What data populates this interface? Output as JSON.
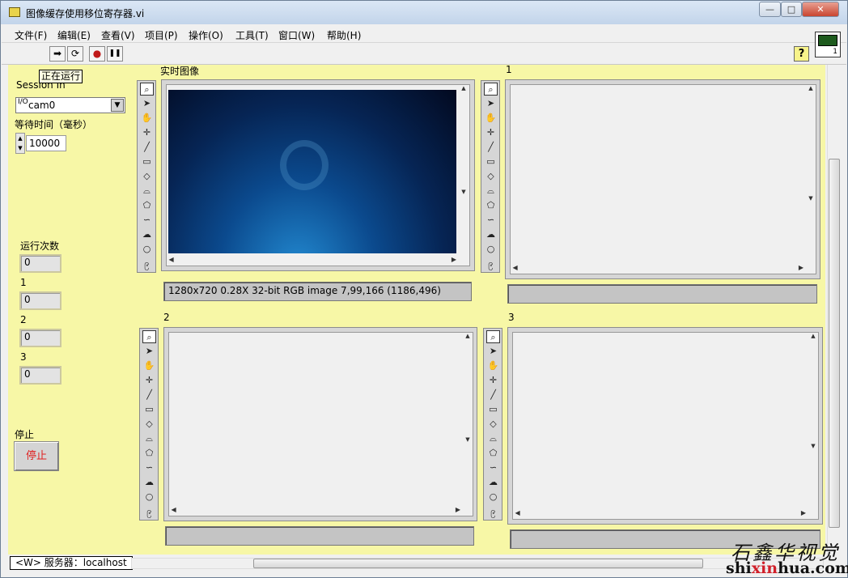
{
  "window": {
    "title": "图像缓存使用移位寄存器.vi",
    "minimize_label": "—",
    "maximize_label": "□",
    "close_label": "✕"
  },
  "menu": [
    "文件(F)",
    "编辑(E)",
    "查看(V)",
    "项目(P)",
    "操作(O)",
    "工具(T)",
    "窗口(W)",
    "帮助(H)"
  ],
  "toolbar": {
    "tooltip": "正在运行",
    "run": "➡",
    "run_continuous": "⟳",
    "abort": "●",
    "pause": "❚❚",
    "help": "?"
  },
  "vi_icon": {
    "number": "1"
  },
  "controls": {
    "session_label": "Session In",
    "session_value": "cam0",
    "session_prefix": "I/O",
    "wait_label": "等待时间（毫秒）",
    "wait_value": "10000",
    "count_label": "运行次数",
    "count_value": "0",
    "ind1_label": "1",
    "ind1_value": "0",
    "ind2_label": "2",
    "ind2_value": "0",
    "ind3_label": "3",
    "ind3_value": "0",
    "stop_label": "停止",
    "stop_button": "停止"
  },
  "displays": {
    "live_title": "实时图像",
    "live_info": "1280x720 0.28X 32-bit RGB image 7,99,166    (1186,496)",
    "d1_title": "1",
    "d2_title": "2",
    "d3_title": "3"
  },
  "status": {
    "server": "<W> 服务器：localhost"
  },
  "watermark": {
    "cn": "石鑫华视觉",
    "en_a": "shi",
    "en_b": "xin",
    "en_c": "hua.com"
  },
  "colors": {
    "panel_bg": "#f7f7a6",
    "stop_text": "#e02020",
    "watermark_red": "#d0202a"
  }
}
